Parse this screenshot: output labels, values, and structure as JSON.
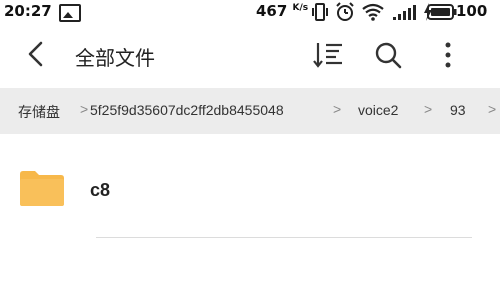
{
  "status_bar": {
    "time": "20:27",
    "speed_value": "467",
    "speed_unit": "K/s",
    "battery": "100"
  },
  "toolbar": {
    "title": "全部文件"
  },
  "breadcrumb": {
    "items": [
      "存储盘",
      "5f25f9d35607dc2ff2db8455048",
      "voice2",
      "93"
    ]
  },
  "files": [
    {
      "name": "c8",
      "type": "folder"
    }
  ],
  "colors": {
    "folder": "#f7b84a",
    "breadcrumb_bg": "#ececec"
  }
}
